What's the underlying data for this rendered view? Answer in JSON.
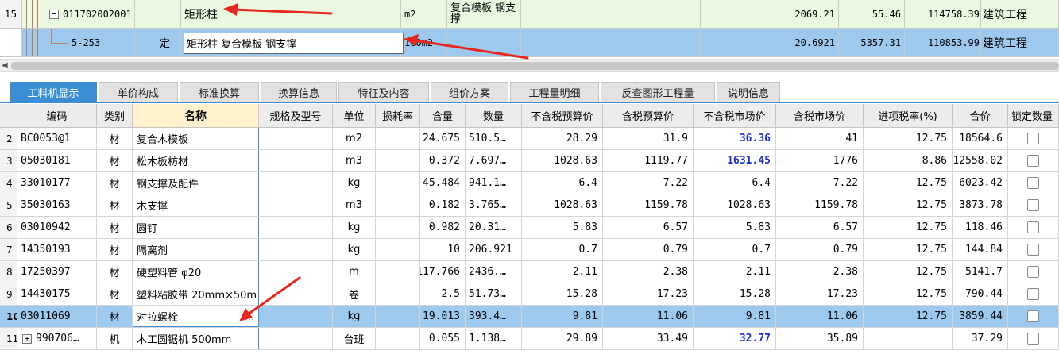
{
  "top_rows": [
    {
      "row_num": "15",
      "code": "011702002001",
      "type": "",
      "name": "矩形柱",
      "spec": "",
      "unit": "m2",
      "feature": "复合模板 钢支撑",
      "qty": "2069.21",
      "price": "55.46",
      "total": "114758.39",
      "profession": "建筑工程",
      "expander": "−"
    },
    {
      "row_num": "",
      "code": "5-253",
      "type": "定",
      "name": "矩形柱 复合模板 钢支撑",
      "spec": "",
      "unit": "100m2",
      "feature": "",
      "qty": "20.6921",
      "price": "5357.31",
      "total": "110853.99",
      "profession": "建筑工程"
    }
  ],
  "tabs": [
    {
      "label": "工料机显示",
      "active": true
    },
    {
      "label": "单价构成"
    },
    {
      "label": "标准换算"
    },
    {
      "label": "换算信息"
    },
    {
      "label": "特征及内容"
    },
    {
      "label": "组价方案"
    },
    {
      "label": "工程量明细"
    },
    {
      "label": "反查图形工程量"
    },
    {
      "label": "说明信息"
    }
  ],
  "detail_headers": {
    "code": "编码",
    "cat": "类别",
    "name": "名称",
    "spec": "规格及型号",
    "unit": "单位",
    "loss": "损耗率",
    "content": "含量",
    "qty": "数量",
    "budget_ex": "不含税预算价",
    "budget_in": "含税预算价",
    "market_ex": "不含税市场价",
    "market_in": "含税市场价",
    "tax": "进项税率(%)",
    "total": "合价",
    "lock": "锁定数量"
  },
  "detail_rows": [
    {
      "num": "2",
      "code": "BC0053@1",
      "cat": "材",
      "name": "复合木模板",
      "spec": "",
      "unit": "m2",
      "loss": "",
      "content": "24.675",
      "qty": "510.5…",
      "budget_ex": "28.29",
      "budget_in": "31.9",
      "market_ex": "36.36",
      "market_hl": true,
      "market_in": "41",
      "tax": "12.75",
      "total": "18564.6"
    },
    {
      "num": "3",
      "code": "05030181",
      "cat": "材",
      "name": "松木板枋材",
      "spec": "",
      "unit": "m3",
      "loss": "",
      "content": "0.372",
      "qty": "7.697…",
      "budget_ex": "1028.63",
      "budget_in": "1119.77",
      "market_ex": "1631.45",
      "market_hl": true,
      "market_in": "1776",
      "tax": "8.86",
      "total": "12558.02"
    },
    {
      "num": "4",
      "code": "33010177",
      "cat": "材",
      "name": "钢支撑及配件",
      "spec": "",
      "unit": "kg",
      "loss": "",
      "content": "45.484",
      "qty": "941.1…",
      "budget_ex": "6.4",
      "budget_in": "7.22",
      "market_ex": "6.4",
      "market_in": "7.22",
      "tax": "12.75",
      "total": "6023.42"
    },
    {
      "num": "5",
      "code": "35030163",
      "cat": "材",
      "name": "木支撑",
      "spec": "",
      "unit": "m3",
      "loss": "",
      "content": "0.182",
      "qty": "3.765…",
      "budget_ex": "1028.63",
      "budget_in": "1159.78",
      "market_ex": "1028.63",
      "market_in": "1159.78",
      "tax": "12.75",
      "total": "3873.78"
    },
    {
      "num": "6",
      "code": "03010942",
      "cat": "材",
      "name": "圆钉",
      "spec": "",
      "unit": "kg",
      "loss": "",
      "content": "0.982",
      "qty": "20.31…",
      "budget_ex": "5.83",
      "budget_in": "6.57",
      "market_ex": "5.83",
      "market_in": "6.57",
      "tax": "12.75",
      "total": "118.46"
    },
    {
      "num": "7",
      "code": "14350193",
      "cat": "材",
      "name": "隔离剂",
      "spec": "",
      "unit": "kg",
      "loss": "",
      "content": "10",
      "qty": "206.921",
      "budget_ex": "0.7",
      "budget_in": "0.79",
      "market_ex": "0.7",
      "market_in": "0.79",
      "tax": "12.75",
      "total": "144.84"
    },
    {
      "num": "8",
      "code": "17250397",
      "cat": "材",
      "name": "硬塑料管 φ20",
      "spec": "",
      "unit": "m",
      "loss": "",
      "content": "117.766",
      "qty": "2436.…",
      "budget_ex": "2.11",
      "budget_in": "2.38",
      "market_ex": "2.11",
      "market_in": "2.38",
      "tax": "12.75",
      "total": "5141.7"
    },
    {
      "num": "9",
      "code": "14430175",
      "cat": "材",
      "name": "塑料粘胶带 20mm×50m",
      "spec": "",
      "unit": "卷",
      "loss": "",
      "content": "2.5",
      "qty": "51.73…",
      "budget_ex": "15.28",
      "budget_in": "17.23",
      "market_ex": "15.28",
      "market_in": "17.23",
      "tax": "12.75",
      "total": "790.44"
    },
    {
      "num": "10",
      "code": "03011069",
      "cat": "材",
      "name": "对拉螺栓",
      "spec": "",
      "unit": "kg",
      "loss": "",
      "content": "19.013",
      "qty": "393.4…",
      "budget_ex": "9.81",
      "budget_in": "11.06",
      "market_ex": "9.81",
      "market_in": "11.06",
      "tax": "12.75",
      "total": "3859.44",
      "selected": true,
      "more": "…"
    },
    {
      "num": "11",
      "code": "990706…",
      "cat": "机",
      "name": "木工圆锯机 500mm",
      "spec": "",
      "unit": "台班",
      "loss": "",
      "content": "0.055",
      "qty": "1.138…",
      "budget_ex": "29.89",
      "budget_in": "33.49",
      "market_ex": "32.77",
      "market_hl": true,
      "market_in": "35.89",
      "tax": "",
      "total": "37.29",
      "expander": "+"
    }
  ],
  "colors": {
    "row_green": "#e9f8df",
    "row_selected": "#9dc9ee",
    "tab_active": "#3b8ed4",
    "highlight_blue": "#1a2fd6",
    "annotation_red": "#e8281e"
  }
}
